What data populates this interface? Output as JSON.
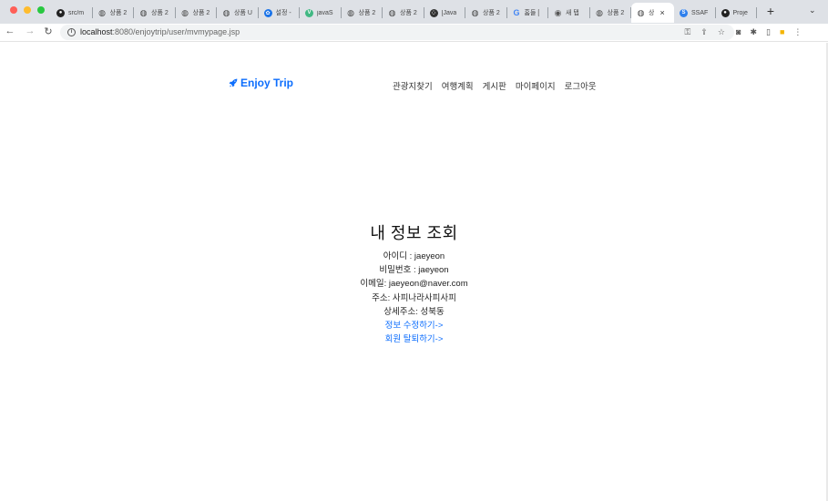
{
  "browser": {
    "tabs": [
      {
        "title": "src/m",
        "icon": "github-icon",
        "color": "#222222"
      },
      {
        "title": "상품 2",
        "icon": "globe-icon",
        "color": "#444444"
      },
      {
        "title": "상품 2",
        "icon": "globe-icon",
        "color": "#444444"
      },
      {
        "title": "상품 2",
        "icon": "globe-icon",
        "color": "#444444"
      },
      {
        "title": "상품 U",
        "icon": "globe-icon",
        "color": "#444444"
      },
      {
        "title": "설정 -",
        "icon": "gear-icon",
        "color": "#1a73e8"
      },
      {
        "title": "javaS",
        "icon": "v-icon",
        "color": "#41b883"
      },
      {
        "title": "상품 2",
        "icon": "globe-icon",
        "color": "#444444"
      },
      {
        "title": "상품 2",
        "icon": "globe-icon",
        "color": "#444444"
      },
      {
        "title": "[Java",
        "icon": "t-icon",
        "color": "#333333"
      },
      {
        "title": "상품 2",
        "icon": "globe-icon",
        "color": "#444444"
      },
      {
        "title": "홈들 [",
        "icon": "google-icon",
        "color": "#4285f4"
      },
      {
        "title": "새 탭",
        "icon": "chrome-icon",
        "color": "#555555"
      },
      {
        "title": "상품 2",
        "icon": "globe-icon",
        "color": "#444444"
      },
      {
        "title": "상",
        "icon": "globe-icon",
        "color": "#444444",
        "active": true
      },
      {
        "title": "SSAF",
        "icon": "ssafy-icon",
        "color": "#2f80ed"
      },
      {
        "title": "Proje",
        "icon": "github-icon",
        "color": "#222222"
      }
    ],
    "close_symbol": "×",
    "new_tab_symbol": "+",
    "tab_menu_symbol": "⌄",
    "url_host": "localhost",
    "url_rest": ":8080/enjoytrip/user/mvmypage.jsp"
  },
  "site": {
    "brand": "Enjoy Trip",
    "brand_color": "#0d6efd",
    "nav": [
      "관광지찾기",
      "여행계획",
      "게시판",
      "마이페이지",
      "로그아웃"
    ]
  },
  "profile": {
    "title": "내 정보 조회",
    "id_line": "아이디 : jaeyeon",
    "password_line": "비밀번호 : jaeyeon",
    "email_line": "이메일: jaeyeon@naver.com",
    "address_line": "주소: 사피나라사피사피",
    "detail_address_line": "상세주소: 성북동",
    "edit_link": "정보 수정하기->",
    "withdraw_link": "회원 탈퇴하기->"
  }
}
